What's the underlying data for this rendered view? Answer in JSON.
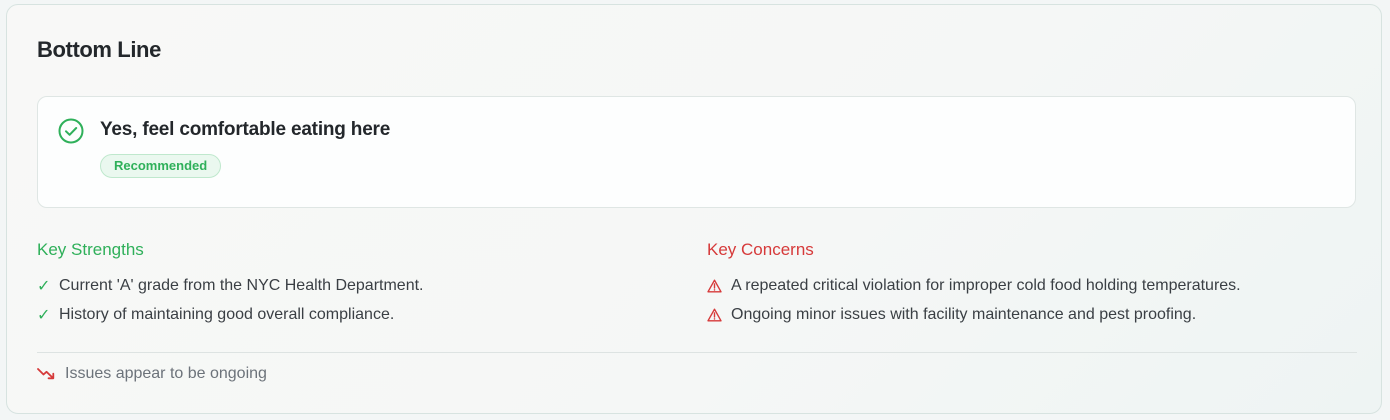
{
  "header": {
    "title": "Bottom Line"
  },
  "verdict": {
    "text": "Yes, feel comfortable eating here",
    "badge": "Recommended",
    "icon": "check-circle-icon",
    "color": "#2fb05a"
  },
  "strengths": {
    "heading": "Key Strengths",
    "color": "#2fb05a",
    "marker": "✓",
    "items": [
      "Current 'A' grade from the NYC Health Department.",
      "History of maintaining good overall compliance."
    ]
  },
  "concerns": {
    "heading": "Key Concerns",
    "color": "#d63a3a",
    "icon": "warning-triangle-icon",
    "items": [
      "A repeated critical violation for improper cold food holding temperatures.",
      "Ongoing minor issues with facility maintenance and pest proofing."
    ]
  },
  "trend": {
    "text": "Issues appear to be ongoing",
    "icon": "trending-down-icon",
    "color": "#d63a3a"
  }
}
